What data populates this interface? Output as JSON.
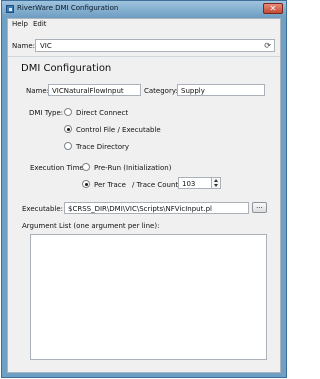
{
  "window": {
    "title": "RiverWare DMI Configuration"
  },
  "menu": {
    "items": [
      "Help",
      "Edit"
    ]
  },
  "name_row": {
    "label": "Name:",
    "value": "VIC"
  },
  "section": {
    "title": "DMI Configuration"
  },
  "dmi": {
    "name_label": "Name:",
    "name_value": "VICNaturalFlowInput",
    "category_label": "Category:",
    "category_value": "Supply",
    "type_label": "DMI Type:",
    "type_options": [
      "Direct Connect",
      "Control File / Executable",
      "Trace Directory"
    ],
    "type_selected": "Control File / Executable"
  },
  "execution": {
    "label": "Execution Time:",
    "options": [
      "Pre-Run (Initialization)",
      "Per Trace"
    ],
    "selected": "Per Trace",
    "trace_count_label": "/ Trace Count:",
    "trace_count": "103"
  },
  "executable": {
    "label": "Executable:",
    "value": "$CRSS_DIR\\DMI\\VIC\\Scripts\\NFVicInput.pl",
    "browse_label": "..."
  },
  "arguments": {
    "label": "Argument List (one argument per line):",
    "value": ""
  },
  "colors": {
    "titlebar": "#6f9fc3",
    "window_bg": "#f0f0f0",
    "close": "#c24a35"
  },
  "icons": {
    "app": "riverware-app-icon",
    "close": "close-icon",
    "refresh": "refresh-icon"
  }
}
